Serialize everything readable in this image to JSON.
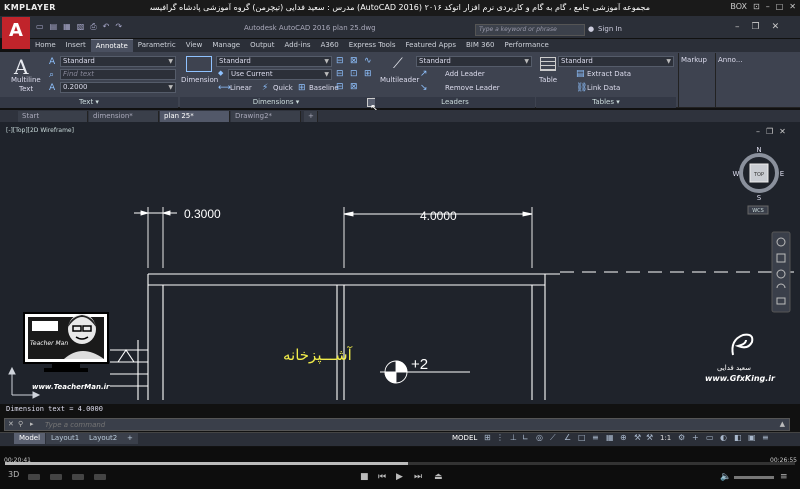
{
  "player": {
    "logo": "KMPLAYER",
    "title": "مجموعه آموزشی جامع ، گام به گام و کاربردی نرم افزار اتوکد ۲۰۱۶ (AutoCAD 2016) مدرس : سعید فدایی (تیچرمن) گروه آموزشی پادشاه گرافیست ها",
    "box": "BOX",
    "time_current": "00:20:41",
    "time_total": "00:26:55",
    "progress": 0.51
  },
  "acad": {
    "logo": "A",
    "doc_title": "Autodesk AutoCAD 2016   plan 25.dwg",
    "search_placeholder": "Type a keyword or phrase",
    "signin": "Sign In"
  },
  "ribbon_tabs": [
    "Home",
    "Insert",
    "Annotate",
    "Parametric",
    "View",
    "Manage",
    "Output",
    "Add-ins",
    "A360",
    "Express Tools",
    "Featured Apps",
    "BIM 360",
    "Performance"
  ],
  "ribbon": {
    "text": {
      "multiline": "Multiline",
      "multiline2": "Text",
      "style": "Standard",
      "find": "Find text",
      "height": "0.2000",
      "title": "Text"
    },
    "dimensions": {
      "button": "Dimension",
      "style": "Standard",
      "layer": "Use Current",
      "linear": "Linear",
      "quick": "Quick",
      "baseline": "Baseline",
      "title": "Dimensions"
    },
    "leaders": {
      "button": "Multileader",
      "style": "Standard",
      "add": "Add Leader",
      "remove": "Remove Leader",
      "title": "Leaders"
    },
    "tables": {
      "button": "Table",
      "style": "Standard",
      "extract": "Extract Data",
      "link": "Link Data",
      "title": "Tables"
    },
    "markup": "Markup",
    "annotation": "Anno..."
  },
  "doc_tabs": [
    "Start",
    "dimension*",
    "plan 25*",
    "Drawing2*"
  ],
  "viewport_label": "[-][Top][2D Wireframe]",
  "drawing": {
    "dim1": "0.3000",
    "dim2": "4.0000",
    "room": "آشـــپزخانه",
    "level": "+2"
  },
  "navcube": {
    "top": "TOP",
    "n": "N",
    "s": "S",
    "e": "E",
    "w": "W",
    "wcs": "WCS"
  },
  "cmd": {
    "history": "Dimension text = 4.0000",
    "placeholder": "Type a command"
  },
  "layout_tabs": [
    "Model",
    "Layout1",
    "Layout2"
  ],
  "status": {
    "model": "MODEL",
    "scale": "1:1"
  },
  "watermarks": {
    "teacher": "www.TeacherMan.ir",
    "teacher_badge": "Teacher Man",
    "gfx": "www.GfxKing.ir",
    "name": "سعید فدایی"
  },
  "colors": {
    "canvas_bg": "#1f232b",
    "ribbon_bg": "#3e4350",
    "accent_red": "#c0242b",
    "room_text": "#f1ec4a"
  }
}
